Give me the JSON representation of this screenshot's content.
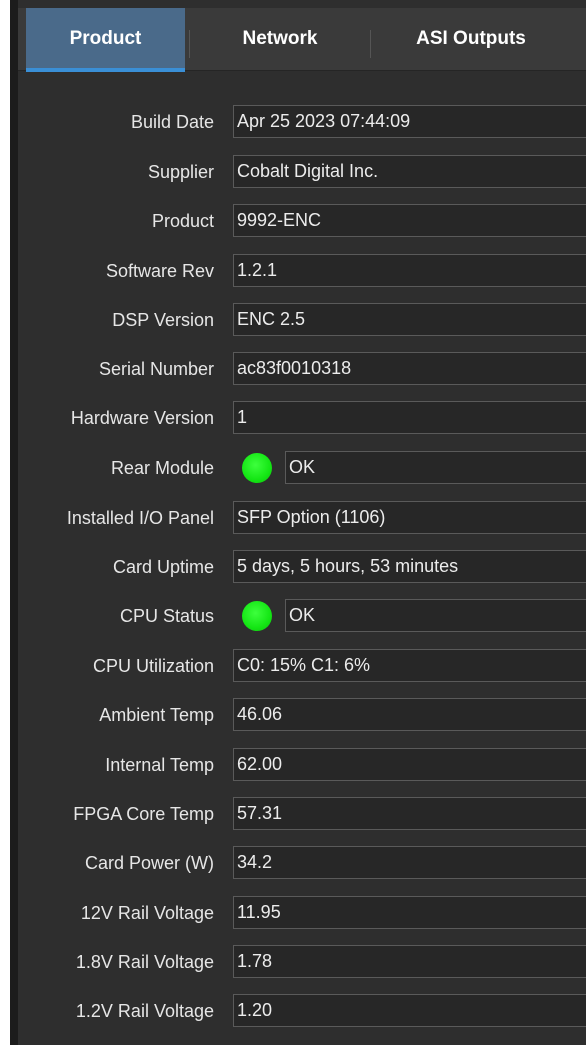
{
  "tabs": [
    {
      "label": "Product",
      "active": true
    },
    {
      "label": "Network",
      "active": false
    },
    {
      "label": "ASI Outputs",
      "active": false
    }
  ],
  "colors": {
    "active_tab": "#4a6a8a",
    "tab_underline": "#3a8fd6",
    "status_ok": "#14e614",
    "panel_bg": "#2e2e2e"
  },
  "fields": {
    "build_date": {
      "label": "Build Date",
      "value": "Apr 25 2023 07:44:09"
    },
    "supplier": {
      "label": "Supplier",
      "value": "Cobalt Digital Inc."
    },
    "product": {
      "label": "Product",
      "value": "9992-ENC"
    },
    "software_rev": {
      "label": "Software Rev",
      "value": "1.2.1"
    },
    "dsp_version": {
      "label": "DSP Version",
      "value": "ENC 2.5"
    },
    "serial_number": {
      "label": "Serial Number",
      "value": "ac83f0010318"
    },
    "hardware_version": {
      "label": "Hardware Version",
      "value": "1"
    },
    "rear_module": {
      "label": "Rear Module",
      "value": "OK",
      "indicator": "green-led-icon"
    },
    "installed_io_panel": {
      "label": "Installed I/O Panel",
      "value": "SFP Option (1106)"
    },
    "card_uptime": {
      "label": "Card Uptime",
      "value": "5 days, 5 hours, 53 minutes"
    },
    "cpu_status": {
      "label": "CPU Status",
      "value": "OK",
      "indicator": "green-led-icon"
    },
    "cpu_utilization": {
      "label": "CPU Utilization",
      "value": "C0: 15% C1: 6%"
    },
    "ambient_temp": {
      "label": "Ambient Temp",
      "value": "46.06"
    },
    "internal_temp": {
      "label": "Internal Temp",
      "value": "62.00"
    },
    "fpga_core_temp": {
      "label": "FPGA Core Temp",
      "value": "57.31"
    },
    "card_power": {
      "label": "Card Power (W)",
      "value": "34.2"
    },
    "rail_12v": {
      "label": "12V Rail Voltage",
      "value": "11.95"
    },
    "rail_1_8v": {
      "label": "1.8V Rail Voltage",
      "value": "1.78"
    },
    "rail_1_2v": {
      "label": "1.2V Rail Voltage",
      "value": "1.20"
    }
  }
}
